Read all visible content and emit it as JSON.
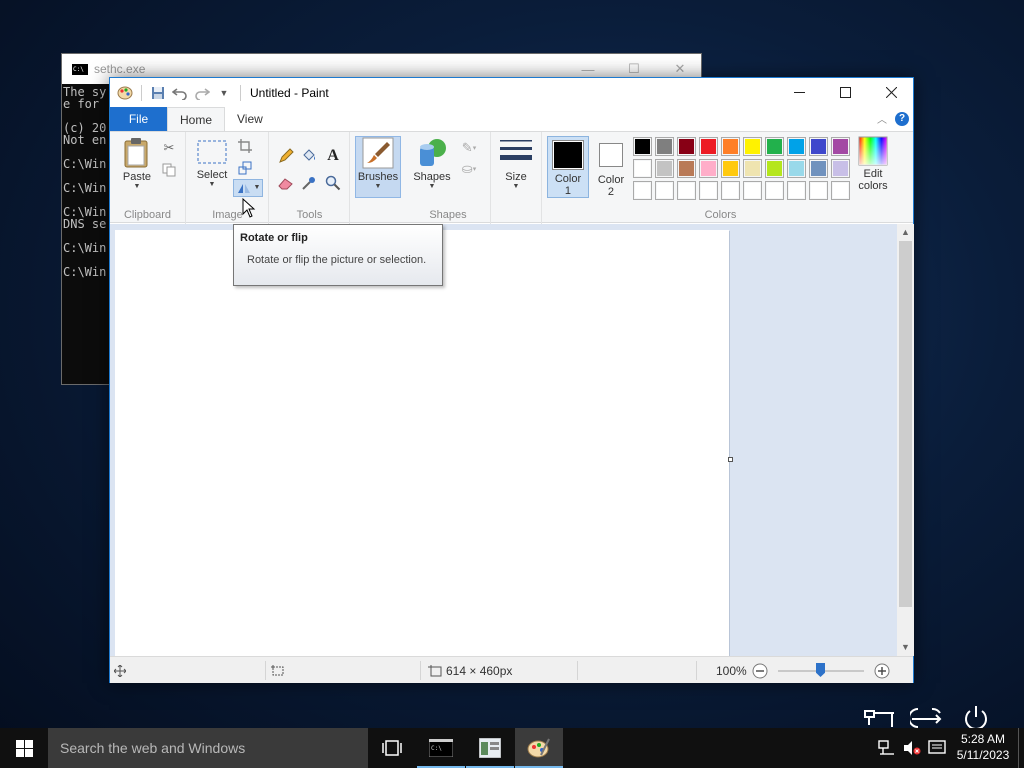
{
  "cmd": {
    "title": "sethc.exe",
    "lines": [
      "The sy",
      "e for",
      "",
      "(c) 20",
      "Not en",
      "",
      "C:\\Win",
      "",
      "C:\\Win",
      "",
      "C:\\Win",
      "DNS se",
      "",
      "C:\\Win",
      "",
      "C:\\Win"
    ]
  },
  "paint": {
    "title": "Untitled - Paint",
    "tabs": {
      "file": "File",
      "home": "Home",
      "view": "View"
    },
    "groups": {
      "clipboard": "Clipboard",
      "image": "Image",
      "tools": "Tools",
      "shapes": "Shapes",
      "colors": "Colors"
    },
    "buttons": {
      "paste": "Paste",
      "select": "Select",
      "brushes": "Brushes",
      "shapes": "Shapes",
      "size": "Size",
      "color1_line1": "Color",
      "color1_line2": "1",
      "color2_line1": "Color",
      "color2_line2": "2",
      "edit_colors_line1": "Edit",
      "edit_colors_line2": "colors"
    },
    "color1": "#000000",
    "color2": "#ffffff",
    "palette_row1": [
      "#000000",
      "#7f7f7f",
      "#880015",
      "#ed1c24",
      "#ff7f27",
      "#fff200",
      "#22b14c",
      "#00a2e8",
      "#3f48cc",
      "#a349a4"
    ],
    "palette_row2": [
      "#ffffff",
      "#c3c3c3",
      "#b97a57",
      "#ffaec9",
      "#ffc90e",
      "#efe4b0",
      "#b5e61d",
      "#99d9ea",
      "#7092be",
      "#c8bfe7"
    ],
    "palette_row3": [
      "#ffffff",
      "#ffffff",
      "#ffffff",
      "#ffffff",
      "#ffffff",
      "#ffffff",
      "#ffffff",
      "#ffffff",
      "#ffffff",
      "#ffffff"
    ],
    "status": {
      "image_size": "614 × 460px",
      "zoom": "100%"
    },
    "tooltip": {
      "title": "Rotate or flip",
      "body": "Rotate or flip the picture or selection."
    }
  },
  "taskbar": {
    "search_placeholder": "Search the web and Windows",
    "time": "5:28 AM",
    "date": "5/11/2023"
  }
}
